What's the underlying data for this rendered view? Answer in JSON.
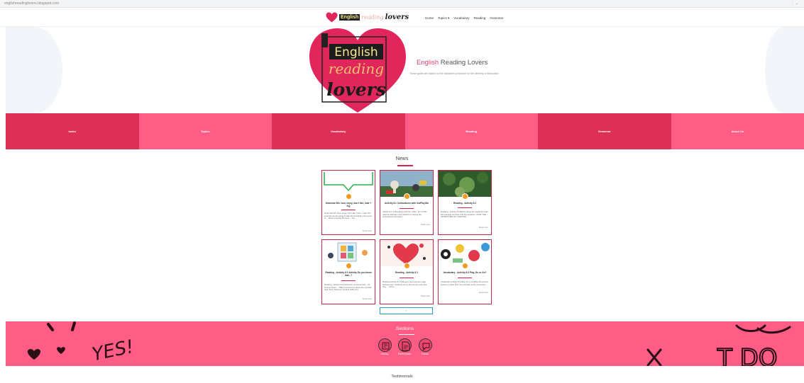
{
  "topbar": {
    "blog_url": "englishreadinglovers.blogspot.com",
    "tools": "⋮ ⌄"
  },
  "header": {
    "logo": {
      "english": "English",
      "reading": "reading",
      "lovers": "lovers"
    },
    "nav": [
      "Home",
      "Topics ▾",
      "Vocabulary",
      "Reading",
      "Grammar"
    ]
  },
  "hero": {
    "logo": {
      "english": "English",
      "reading": "reading",
      "lovers": "lovers"
    },
    "title_accent": "English",
    "title_rest": " Reading Lovers",
    "subtitle": "These goals are based on the standard curriculum for the Ministry of Education"
  },
  "categories": [
    {
      "label": "Index",
      "color": "#dd3056"
    },
    {
      "label": "Topics",
      "color": "#ff5c86"
    },
    {
      "label": "Vocabulary",
      "color": "#dd3056"
    },
    {
      "label": "Reading",
      "color": "#ff5c86"
    },
    {
      "label": "Grammar",
      "color": "#dd3056"
    },
    {
      "label": "About Us",
      "color": "#ff5c86"
    }
  ],
  "news": {
    "title": "News",
    "cards": [
      {
        "title": "Grammar 6th: how, enjoy, don't like, hate + ing",
        "excerpt": "Grammar 6th: How, enjoy, don't like, hate + ingIn this exercise we are going to talk about feelings. Everyone is ... about enjoying the best ... ing ...",
        "date": "Read more",
        "thumb": "speech-bubble"
      },
      {
        "title": "Activity 8.1 Collocations with Go/Play/Do",
        "excerpt": "Activity 8.1 Collocations with Go / Play / Do/ In this read we will learn and practice by saying the sentences by knowing ...",
        "date": "Read more",
        "thumb": "chess"
      },
      {
        "title": "Reading - Activity 8.2",
        "excerpt": "Reading - Activity 8.2 Before doing the questions read the passage and then find the answers. LOOK THE ADVENTURE OF CHAPTER ...",
        "date": "Read more",
        "thumb": "forest"
      },
      {
        "title": "Reading - Activity 8.3 Activity Do you know that...?",
        "excerpt": "Reading - Activity 8.3 Activity Do you know that... Of course all are ... Make connections about the exercise have been based on student skills and ...",
        "date": "Read more",
        "thumb": "puzzle"
      },
      {
        "title": "Reading - Activity 8.1",
        "excerpt": "Reading Activity 8.1 Dialogue: Let's join the rugby between two. Students prove that we are sure that they ... prove ...",
        "date": "Read more",
        "thumb": "heart-art"
      },
      {
        "title": "Vocabulary - Activity 8.3 Play, Do or Go?",
        "excerpt": "Vocabulary Activity 8.3 Play, Do or Go/Play the person sports to match their use correctly to the sentences ...",
        "date": "Read more",
        "thumb": "sports"
      }
    ],
    "load_more": "+"
  },
  "sections": {
    "title": "Sections",
    "items": [
      {
        "label": "Library",
        "icon": "library-icon"
      },
      {
        "label": "References",
        "icon": "references-icon"
      },
      {
        "label": "Forum",
        "icon": "forum-icon"
      }
    ]
  },
  "testimonials": {
    "title": "Testimonials"
  },
  "colors": {
    "primary": "#ff5c86",
    "dark": "#dd3056",
    "accent_line": "#d8234e",
    "badge": "#f59a21",
    "link": "#2a9ac2"
  }
}
